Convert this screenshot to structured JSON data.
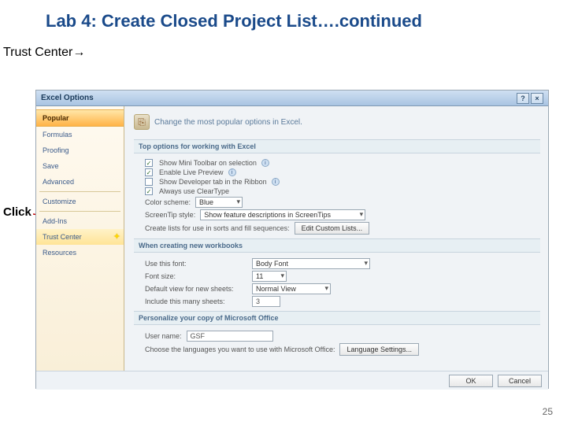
{
  "slide": {
    "title": "Lab 4: Create Closed Project List….continued",
    "trust_center_label": "Trust Center→",
    "click_label": "Click",
    "page_number": "25"
  },
  "dialog": {
    "title": "Excel Options",
    "help": "?",
    "close": "×",
    "sidebar": {
      "items": [
        "Popular",
        "Formulas",
        "Proofing",
        "Save",
        "Advanced",
        "Customize",
        "Add-Ins",
        "Trust Center",
        "Resources"
      ],
      "selected_index": 0,
      "highlight_index": 7
    },
    "header": {
      "icon": "⎘",
      "text": "Change the most popular options in Excel."
    },
    "section1": {
      "title": "Top options for working with Excel",
      "opts": {
        "mini_toolbar": "Show Mini Toolbar on selection",
        "live_preview": "Enable Live Preview",
        "developer_tab": "Show Developer tab in the Ribbon",
        "cleartype": "Always use ClearType"
      },
      "color_scheme_label": "Color scheme:",
      "color_scheme_value": "Blue",
      "screentip_label": "ScreenTip style:",
      "screentip_value": "Show feature descriptions in ScreenTips",
      "lists_label": "Create lists for use in sorts and fill sequences:",
      "lists_button": "Edit Custom Lists..."
    },
    "section2": {
      "title": "When creating new workbooks",
      "font_label": "Use this font:",
      "font_value": "Body Font",
      "size_label": "Font size:",
      "size_value": "11",
      "view_label": "Default view for new sheets:",
      "view_value": "Normal View",
      "sheets_label": "Include this many sheets:",
      "sheets_value": "3"
    },
    "section3": {
      "title": "Personalize your copy of Microsoft Office",
      "user_label": "User name:",
      "user_value": "GSF",
      "lang_label": "Choose the languages you want to use with Microsoft Office:",
      "lang_button": "Language Settings..."
    },
    "buttons": {
      "ok": "OK",
      "cancel": "Cancel"
    }
  }
}
